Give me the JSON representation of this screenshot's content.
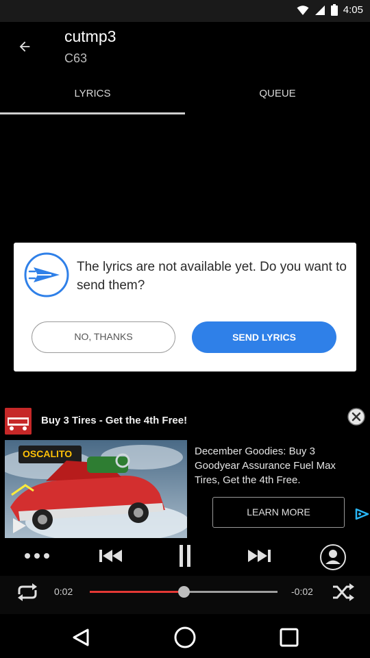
{
  "status_bar": {
    "time": "4:05"
  },
  "header": {
    "title": "cutmp3",
    "artist": "C63"
  },
  "tabs": [
    {
      "label": "LYRICS",
      "active": true
    },
    {
      "label": "QUEUE",
      "active": false
    }
  ],
  "dialog": {
    "message": "The lyrics are not available yet. Do you want to send them?",
    "decline_label": "NO, THANKS",
    "accept_label": "SEND LYRICS",
    "accent_color": "#2f80e8"
  },
  "ad": {
    "title": "Buy 3 Tires - Get the 4th Free!",
    "brand": "OSCALITO",
    "description": "December Goodies: Buy 3 Goodyear Assurance Fuel Max Tires, Get the 4th Free.",
    "cta_label": "LEARN MORE"
  },
  "player": {
    "elapsed": "0:02",
    "remaining": "-0:02",
    "progress_fraction": 0.5,
    "progress_color": "#e53935"
  },
  "icons": {
    "back": "arrow-left-icon",
    "more": "more-dots-icon",
    "rewind": "rewind-icon",
    "pause": "pause-icon",
    "forward": "fast-forward-icon",
    "profile": "person-icon",
    "repeat": "repeat-icon",
    "shuffle": "shuffle-icon"
  }
}
